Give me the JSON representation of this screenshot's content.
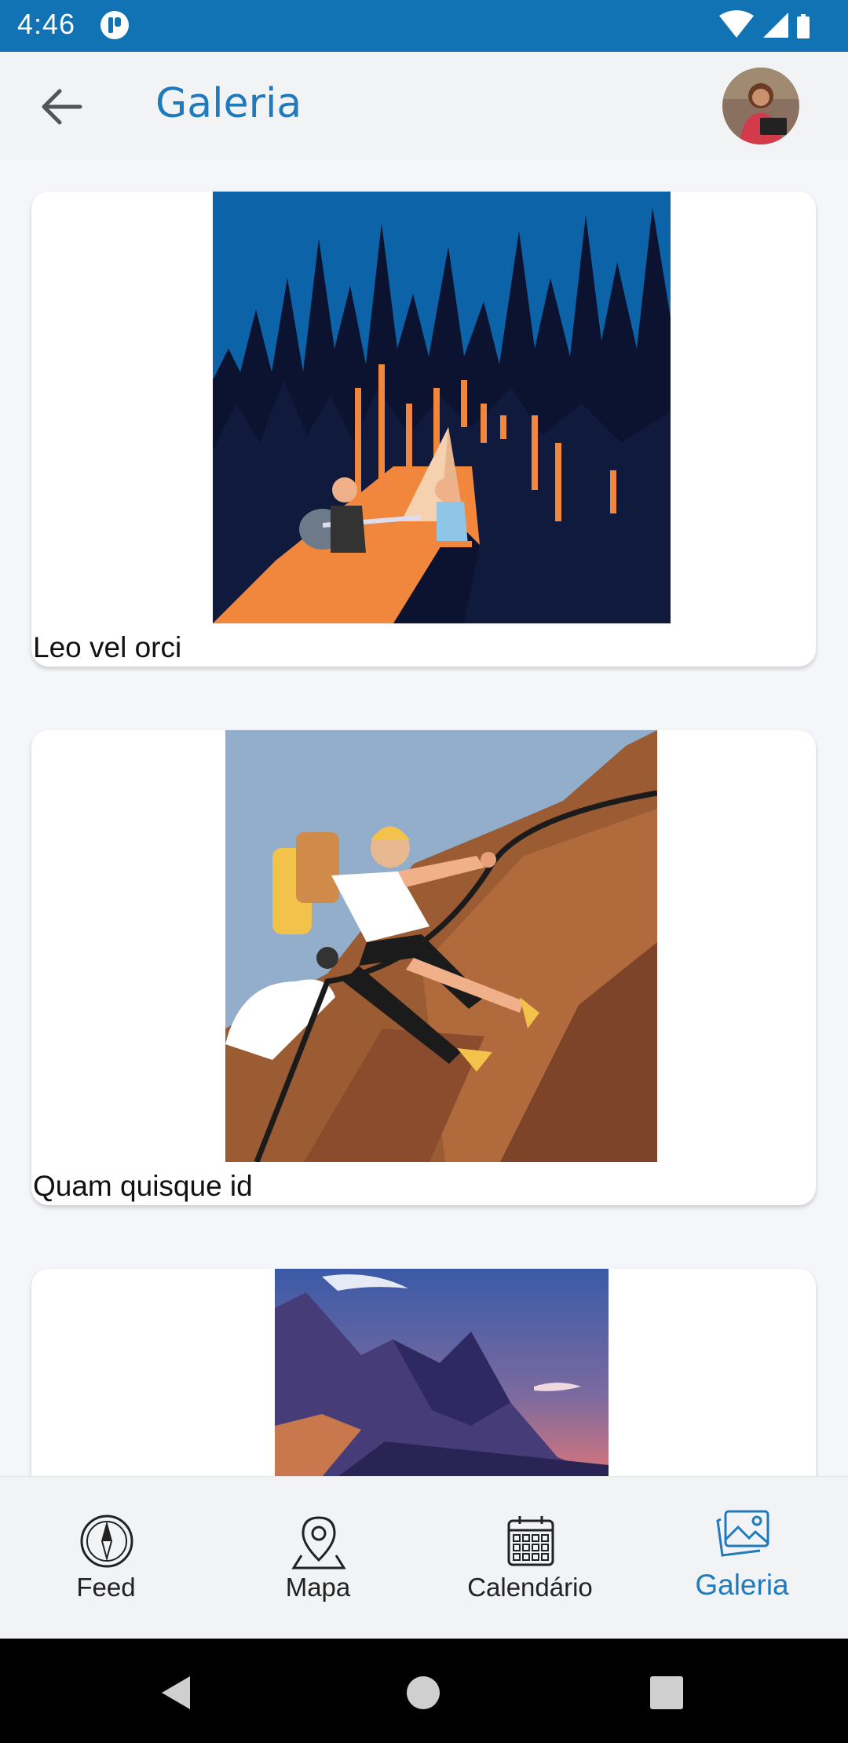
{
  "status_bar": {
    "time": "4:46",
    "notification_icon": "app-notification-icon",
    "icons": [
      "wifi-icon",
      "cell-signal-icon",
      "battery-icon"
    ]
  },
  "app_bar": {
    "back_icon": "arrow-left-icon",
    "title": "Galeria",
    "avatar": "user-avatar"
  },
  "gallery": {
    "items": [
      {
        "caption": "Leo vel orci",
        "image": "campfire-guitar-illustration"
      },
      {
        "caption": "Quam quisque id",
        "image": "rock-climber-illustration"
      },
      {
        "caption": "",
        "image": "mountain-sunset-illustration"
      }
    ]
  },
  "bottom_nav": {
    "items": [
      {
        "label": "Feed",
        "icon": "compass-icon",
        "active": false
      },
      {
        "label": "Mapa",
        "icon": "map-pin-icon",
        "active": false
      },
      {
        "label": "Calendário",
        "icon": "calendar-icon",
        "active": false
      },
      {
        "label": "Galeria",
        "icon": "gallery-icon",
        "active": true
      }
    ]
  },
  "colors": {
    "primary": "#1273b4",
    "accent_text": "#1f7bbd",
    "background": "#f4f6f9"
  }
}
